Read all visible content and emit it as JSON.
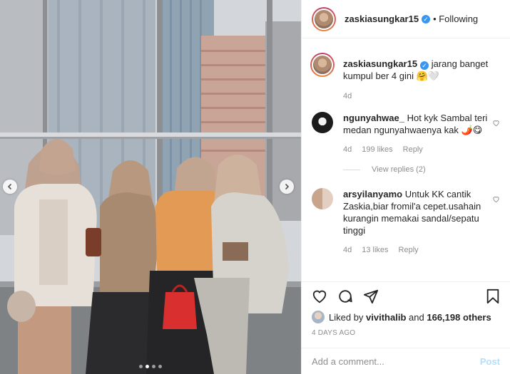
{
  "header": {
    "username": "zaskiasungkar15",
    "follow_label": "• Following"
  },
  "caption": {
    "username": "zaskiasungkar15",
    "text": "jarang banget kumpul ber 4 gini 🤗🤍",
    "time": "4d"
  },
  "comments": [
    {
      "username": "ngunyahwae_",
      "text": "Hot kyk Sambal teri medan ngunyahwaenya kak 🌶️😋",
      "time": "4d",
      "likes": "199 likes",
      "reply_label": "Reply",
      "view_replies": "View replies (2)"
    },
    {
      "username": "arsyilanyamo",
      "text": "Untuk KK cantik Zaskia,biar fromil'a cepet.usahain kurangin memakai sandal/sepatu tinggi",
      "time": "4d",
      "likes": "13 likes",
      "reply_label": "Reply"
    }
  ],
  "likes": {
    "prefix": "Liked by",
    "user": "vivithalib",
    "middle": "and",
    "count": "166,198 others"
  },
  "date": "4 DAYS AGO",
  "add_comment": {
    "placeholder": "Add a comment...",
    "post_label": "Post"
  },
  "carousel": {
    "total": 4,
    "active_index": 1
  },
  "colors": {
    "link_blue": "#3897f0",
    "post_disabled": "#b2dffc",
    "meta_gray": "#8e8e8e"
  },
  "icons": [
    "heart-icon",
    "comment-icon",
    "share-icon",
    "bookmark-icon",
    "verified-icon",
    "chevron-left-icon",
    "chevron-right-icon"
  ]
}
